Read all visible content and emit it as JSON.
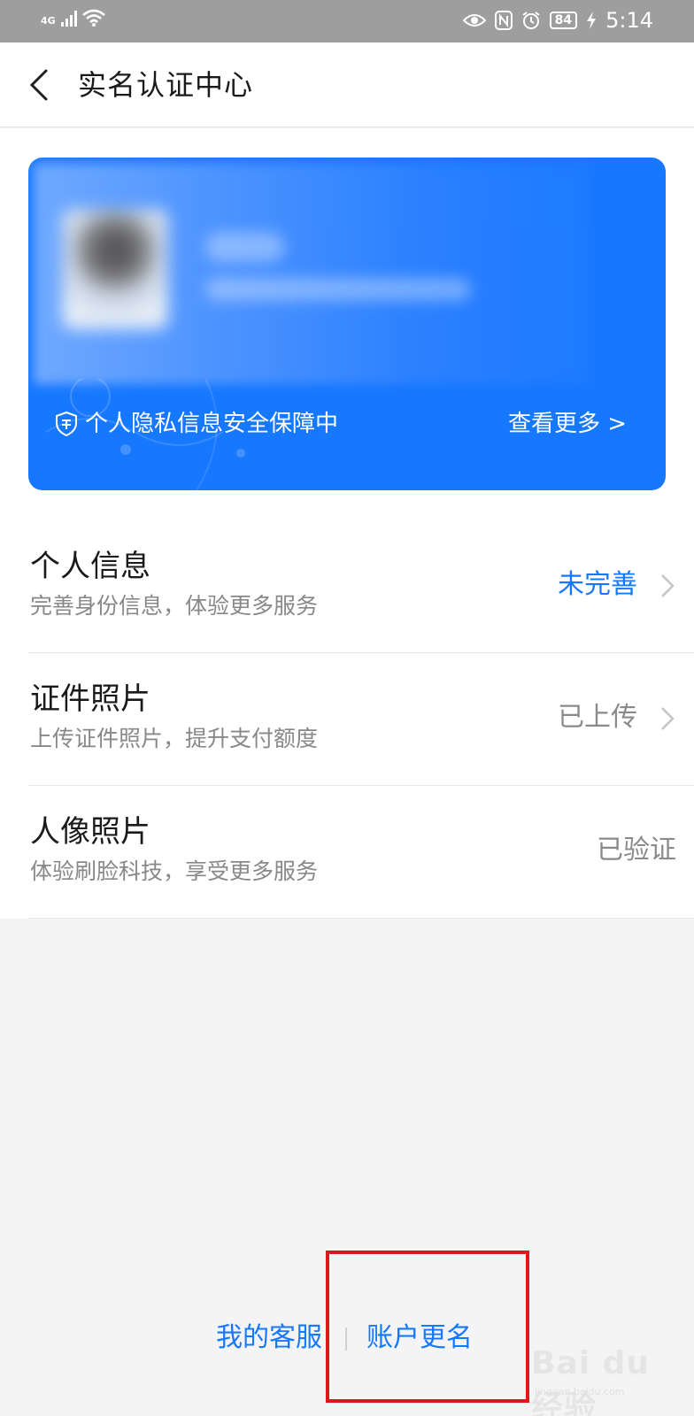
{
  "status_bar": {
    "network": "4G",
    "battery": "84",
    "time": "5:14"
  },
  "header": {
    "title": "实名认证中心"
  },
  "card": {
    "privacy_text": "个人隐私信息安全保障中",
    "view_more": "查看更多 >"
  },
  "list": {
    "items": [
      {
        "title": "个人信息",
        "subtitle": "完善身份信息，体验更多服务",
        "status": "未完善",
        "status_color": "#1677ff",
        "has_chevron": true
      },
      {
        "title": "证件照片",
        "subtitle": "上传证件照片，提升支付额度",
        "status": "已上传",
        "status_color": "#8a8a8a",
        "has_chevron": true
      },
      {
        "title": "人像照片",
        "subtitle": "体验刷脸科技，享受更多服务",
        "status": "已验证",
        "status_color": "#8a8a8a",
        "has_chevron": false
      }
    ]
  },
  "footer": {
    "service_link": "我的客服",
    "rename_link": "账户更名"
  },
  "watermark": {
    "text": "Bai du 经验",
    "sub": "jingyan.baidu.com"
  },
  "colors": {
    "accent": "#1677ff",
    "highlight": "#e0161b"
  },
  "icons": [
    "signal-icon",
    "wifi-icon",
    "eye-icon",
    "nfc-icon",
    "alarm-icon",
    "battery-icon",
    "charging-icon",
    "back-arrow-icon",
    "shield-icon",
    "chevron-right-icon"
  ]
}
